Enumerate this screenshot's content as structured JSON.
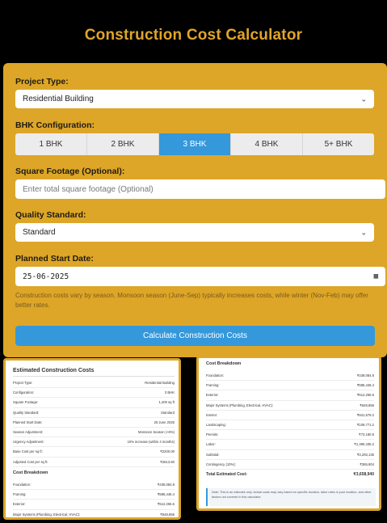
{
  "app": {
    "title": "Construction Cost Calculator"
  },
  "form": {
    "project_type_label": "Project Type:",
    "project_type_value": "Residential Building",
    "bhk_label": "BHK Configuration:",
    "bhk_options": [
      "1 BHK",
      "2 BHK",
      "3 BHK",
      "4 BHK",
      "5+ BHK"
    ],
    "bhk_selected": "3 BHK",
    "sqft_label": "Square Footage (Optional):",
    "sqft_placeholder": "Enter total square footage (Optional)",
    "quality_label": "Quality Standard:",
    "quality_value": "Standard",
    "date_label": "Planned Start Date:",
    "date_value": "25-06-2025",
    "season_note": "Construction costs vary by season. Monsoon season (June-Sep) typically increases costs, while winter (Nov-Feb) may offer better rates.",
    "calculate_label": "Calculate Construction Costs"
  },
  "estimate": {
    "title": "Estimated Construction Costs",
    "rows": [
      {
        "label": "Project Type:",
        "value": "Residential Building"
      },
      {
        "label": "Configuration:",
        "value": "3 BHK"
      },
      {
        "label": "Square Footage:",
        "value": "1,400 sq ft"
      },
      {
        "label": "Quality Standard:",
        "value": "Standard"
      },
      {
        "label": "Planned Start Date:",
        "value": "25 June 2025"
      },
      {
        "label": "Season Adjustment:",
        "value": "Monsoon Season (+8%)"
      },
      {
        "label": "Urgency Adjustment:",
        "value": "10% increase (within 4 months)"
      },
      {
        "label": "Base Cost per sq ft:",
        "value": "₹2200.00"
      },
      {
        "label": "Adjusted Cost per sq ft:",
        "value": "₹2613.60"
      }
    ],
    "breakdown_title": "Cost Breakdown",
    "breakdown_rows": [
      {
        "label": "Foundation:",
        "value": "₹439,084.8"
      },
      {
        "label": "Framing:",
        "value": "₹585,446.4"
      },
      {
        "label": "Exterior:",
        "value": "₹512,265.6"
      },
      {
        "label": "Major Systems (Plumbing, Electrical, HVAC):",
        "value": "₹548,856"
      }
    ]
  },
  "breakdown": {
    "title": "Cost Breakdown",
    "rows": [
      {
        "label": "Foundation:",
        "value": "₹439,084.8"
      },
      {
        "label": "Framing:",
        "value": "₹585,446.4"
      },
      {
        "label": "Exterior:",
        "value": "₹512,265.6"
      },
      {
        "label": "Major Systems (Plumbing, Electrical, HVAC):",
        "value": "₹548,856"
      },
      {
        "label": "Interior:",
        "value": "₹841,579.2"
      },
      {
        "label": "Landscaping:",
        "value": "₹109,771.2"
      },
      {
        "label": "Permits:",
        "value": "₹73,180.8"
      },
      {
        "label": "Labor:",
        "value": "₹1,390,435.2"
      },
      {
        "label": "Subtotal:",
        "value": "₹3,293,136"
      },
      {
        "label": "Contingency (10%):",
        "value": "₹365,904"
      }
    ],
    "total_label": "Total Estimated Cost:",
    "total_value": "₹3,658,940",
    "note": "Note: This is an estimate only. Actual costs may vary based on specific location, labor rates in your location, and other factors not covered in this calculator."
  }
}
